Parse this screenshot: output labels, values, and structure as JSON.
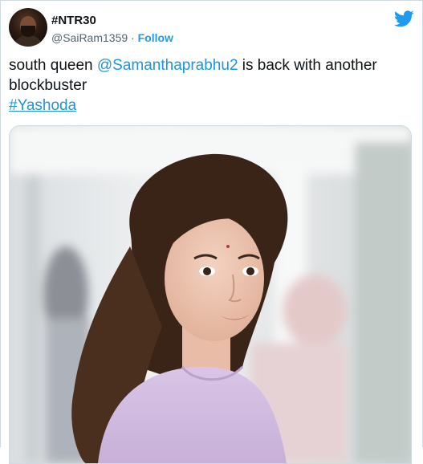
{
  "user": {
    "display_name": "#NTR30",
    "handle": "@SaiRam1359",
    "separator": "·",
    "follow_label": "Follow"
  },
  "tweet": {
    "text_before": "south queen ",
    "mention": "@Samanthaprabhu2",
    "text_after": " is back with another blockbuster",
    "hashtag": "#Yashoda"
  },
  "icons": {
    "platform": "twitter-bird-icon",
    "brand_color": "#1d9bf0"
  }
}
